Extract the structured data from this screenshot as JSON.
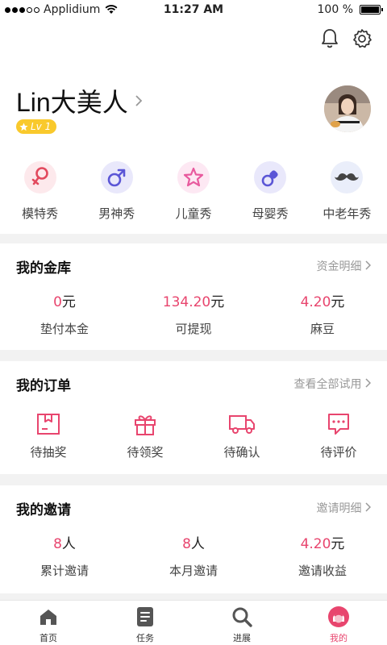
{
  "status_bar": {
    "carrier": "Applidium",
    "time": "11:27 AM",
    "battery": "100 %"
  },
  "header": {
    "username": "Lin大美人",
    "level": "Lv 1",
    "icons": [
      "bell-icon",
      "settings-icon"
    ]
  },
  "categories": [
    {
      "label": "模特秀",
      "icon": "female-icon",
      "color": "#e24a5e",
      "bg": "#fde9ec"
    },
    {
      "label": "男神秀",
      "icon": "male-icon",
      "color": "#5b56d6",
      "bg": "#e9e8fb"
    },
    {
      "label": "儿童秀",
      "icon": "star-icon",
      "color": "#e85a9e",
      "bg": "#fde8f3"
    },
    {
      "label": "母婴秀",
      "icon": "pacifier-icon",
      "color": "#5b56d6",
      "bg": "#e9e8fb"
    },
    {
      "label": "中老年秀",
      "icon": "mustache-icon",
      "color": "#444444",
      "bg": "#eaeefa"
    }
  ],
  "vault": {
    "title": "我的金库",
    "link": "资金明细",
    "stats": [
      {
        "value": "0",
        "unit": "元",
        "label": "垫付本金"
      },
      {
        "value": "134.20",
        "unit": "元",
        "label": "可提现"
      },
      {
        "value": "4.20",
        "unit": "元",
        "label": "麻豆"
      }
    ]
  },
  "orders": {
    "title": "我的订单",
    "link": "查看全部试用",
    "items": [
      {
        "label": "待抽奖",
        "icon": "box-icon"
      },
      {
        "label": "待领奖",
        "icon": "gift-icon"
      },
      {
        "label": "待确认",
        "icon": "truck-icon"
      },
      {
        "label": "待评价",
        "icon": "comment-icon"
      }
    ]
  },
  "invites": {
    "title": "我的邀请",
    "link": "邀请明细",
    "stats": [
      {
        "value": "8",
        "unit": "人",
        "label": "累计邀请"
      },
      {
        "value": "8",
        "unit": "人",
        "label": "本月邀请"
      },
      {
        "value": "4.20",
        "unit": "元",
        "label": "邀请收益"
      }
    ]
  },
  "tabbar": [
    {
      "label": "首页",
      "icon": "home-icon"
    },
    {
      "label": "任务",
      "icon": "task-icon"
    },
    {
      "label": "进展",
      "icon": "search-icon"
    },
    {
      "label": "我的",
      "icon": "profile-icon",
      "active": true
    }
  ],
  "colors": {
    "accent": "#e8456e",
    "badge": "#f9c92c",
    "order_icon": "#e8456e"
  }
}
